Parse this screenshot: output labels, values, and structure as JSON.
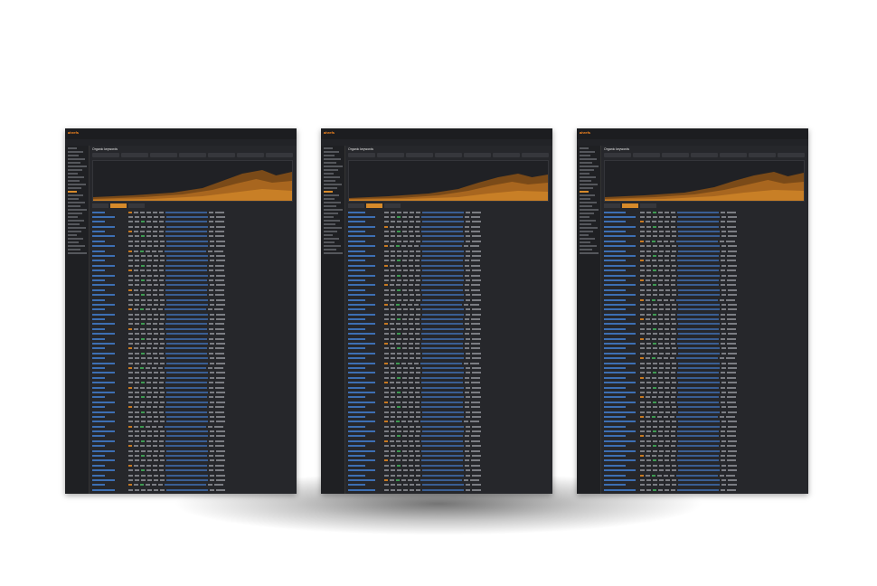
{
  "scene": {
    "description_free": true
  },
  "screenshots": [
    {
      "name": "left",
      "logo": "ahrefs",
      "page_title": "Organic keywords",
      "active_tab": "Organic keywords"
    },
    {
      "name": "center",
      "logo": "ahrefs",
      "page_title": "Organic keywords",
      "active_tab": "Organic keywords"
    },
    {
      "name": "right",
      "logo": "ahrefs",
      "page_title": "Organic keywords",
      "active_tab": "Organic keywords"
    }
  ],
  "colors": {
    "background": "#ffffff",
    "app_bg": "#26272b",
    "accent": "#d68a2a",
    "link": "#3d6fb3",
    "positive": "#3e9b52"
  }
}
